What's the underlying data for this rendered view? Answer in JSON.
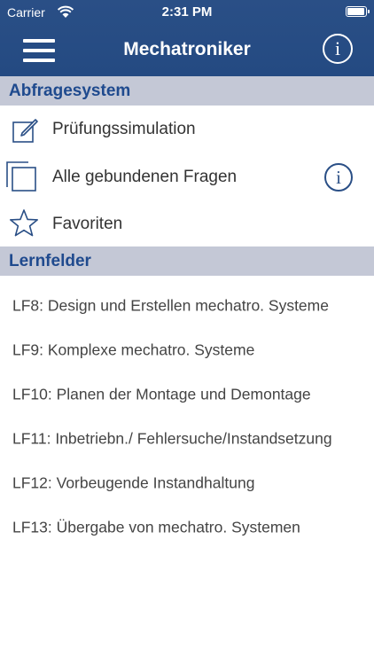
{
  "status_bar": {
    "carrier": "Carrier",
    "time": "2:31 PM",
    "battery_level": 1.0
  },
  "nav": {
    "title": "Mechatroniker",
    "info_glyph": "i"
  },
  "sections": {
    "abfragesystem": {
      "title": "Abfragesystem",
      "items": [
        {
          "label": "Prüfungssimulation",
          "icon": "pencil-edit-icon"
        },
        {
          "label": "Alle gebundenen Fragen",
          "icon": "stacked-pages-icon",
          "info_glyph": "i"
        },
        {
          "label": "Favoriten",
          "icon": "star-icon"
        }
      ]
    },
    "lernfelder": {
      "title": "Lernfelder",
      "items": [
        {
          "label": "LF8: Design und Erstellen mechatro. Systeme"
        },
        {
          "label": "LF9: Komplexe mechatro. Systeme"
        },
        {
          "label": "LF10: Planen der Montage und Demontage"
        },
        {
          "label": "LF11: Inbetriebn./ Fehlersuche/Instandsetzung"
        },
        {
          "label": "LF12: Vorbeugende Instandhaltung"
        },
        {
          "label": "LF13: Übergabe von mechatro. Systemen"
        }
      ]
    }
  },
  "colors": {
    "nav_background": "#2a4f86",
    "section_header_bg": "#c4c8d6",
    "section_header_text": "#1f4a8e",
    "icon_color": "#2a4f86"
  }
}
